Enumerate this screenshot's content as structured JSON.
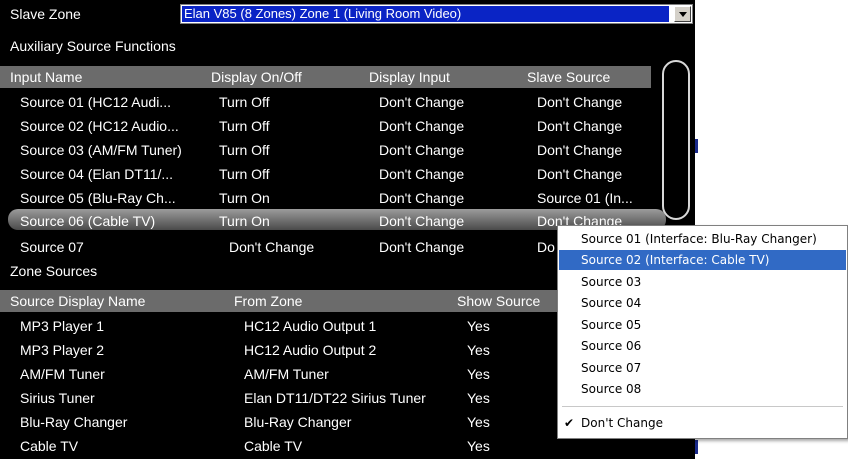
{
  "slave_zone": {
    "label": "Slave Zone",
    "selected": "Elan V85 (8 Zones) Zone 1 (Living Room Video)"
  },
  "aux": {
    "title": "Auxiliary Source Functions",
    "columns": [
      "Input Name",
      "Display On/Off",
      "Display Input",
      "Slave Source"
    ],
    "rows": [
      [
        "Source 01 (HC12  Audi...",
        "Turn Off",
        "Don't Change",
        "Don't Change"
      ],
      [
        "Source 02 (HC12 Audio...",
        "Turn Off",
        "Don't Change",
        "Don't Change"
      ],
      [
        "Source 03 (AM/FM Tuner)",
        "Turn Off",
        "Don't Change",
        "Don't Change"
      ],
      [
        "Source 04 (Elan DT11/...",
        "Turn Off",
        "Don't Change",
        "Don't Change"
      ],
      [
        "Source 05 (Blu-Ray Ch...",
        "Turn On",
        "Don't Change",
        "Source 01 (In..."
      ],
      [
        "Source 06 (Cable TV)",
        "Turn On",
        "Don't Change",
        "Don't Change"
      ],
      [
        "Source 07",
        "Don't Change",
        "Don't Change",
        "Do"
      ]
    ]
  },
  "zone_sources": {
    "title": "Zone Sources",
    "columns": [
      "Source Display Name",
      "From Zone",
      "Show Source"
    ],
    "rows": [
      [
        "MP3 Player 1",
        "HC12  Audio Output 1",
        "Yes"
      ],
      [
        "MP3 Player 2",
        "HC12 Audio Output 2",
        "Yes"
      ],
      [
        "AM/FM Tuner",
        "AM/FM Tuner",
        "Yes"
      ],
      [
        "Sirius Tuner",
        "Elan DT11/DT22 Sirius Tuner",
        "Yes"
      ],
      [
        "Blu-Ray Changer",
        "Blu-Ray Changer",
        "Yes"
      ],
      [
        "Cable TV",
        "Cable TV",
        "Yes"
      ]
    ]
  },
  "popup": {
    "items": [
      "Source 01 (Interface: Blu-Ray Changer)",
      "Source 02 (Interface: Cable TV)",
      "Source 03",
      "Source 04",
      "Source 05",
      "Source 06",
      "Source 07",
      "Source 08"
    ],
    "highlighted_index": 1,
    "checked_item": "Don't Change",
    "check_icon": "checkmark-icon"
  },
  "colors": {
    "panel_bg": "#000000",
    "header_bar": "#6b6b6b",
    "selection_blue": "#0a24c5",
    "menu_highlight": "#316ac5"
  }
}
